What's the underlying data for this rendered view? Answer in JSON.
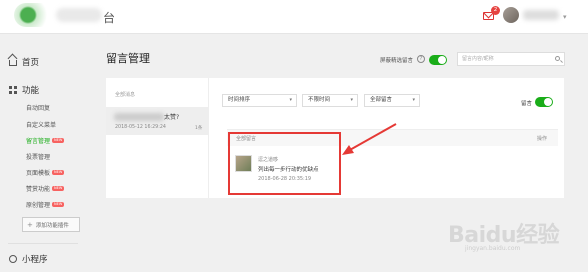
{
  "topbar": {
    "title_partial": "台",
    "mail_badge": "2"
  },
  "sidebar": {
    "home": "首页",
    "features": "功能",
    "items": [
      {
        "label": "自动回复",
        "is_new": false,
        "active": false
      },
      {
        "label": "自定义菜单",
        "is_new": false,
        "active": false
      },
      {
        "label": "留言管理",
        "is_new": true,
        "active": true
      },
      {
        "label": "投票管理",
        "is_new": false,
        "active": false
      },
      {
        "label": "页面模板",
        "is_new": true,
        "active": false
      },
      {
        "label": "赞赏功能",
        "is_new": true,
        "active": false
      },
      {
        "label": "原创管理",
        "is_new": true,
        "active": false
      }
    ],
    "new_tag": "NEW",
    "add_plugin": "添加功能插件",
    "mini_program": "小程序"
  },
  "main": {
    "page_title": "留言管理",
    "selected_label": "屏蔽精选留言",
    "search_placeholder": "留言内容/昵称",
    "left_header": "全部消息",
    "message": {
      "title_suffix": "太赞?",
      "date": "2018-05-12 16:29:24",
      "count": "1条"
    },
    "filters": {
      "sort": "时间排序",
      "time": "不限时间",
      "type": "全部留言"
    },
    "reply_label": "留言",
    "table": {
      "col_left": "全部留言",
      "col_right": "操作"
    },
    "comment": {
      "user": "逗之道哆",
      "text": "列出每一步行动的优缺点",
      "date": "2018-06-28 20:35:19"
    }
  },
  "watermark": {
    "brand": "Baidu经验",
    "sub": "jingyan.baidu.com"
  },
  "colors": {
    "accent": "#1aad19",
    "highlight": "#e53935",
    "badge": "#e64340"
  }
}
